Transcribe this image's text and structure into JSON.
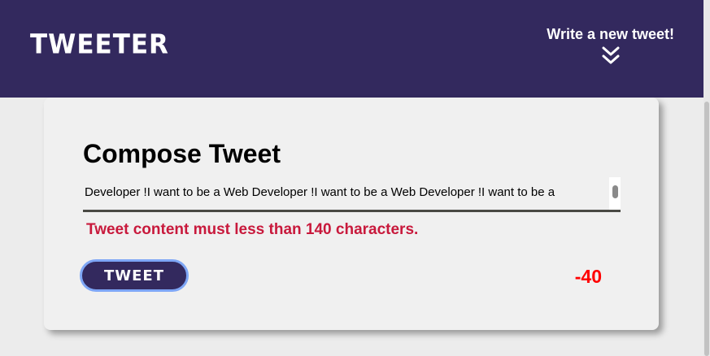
{
  "nav": {
    "logo": "TWEETER",
    "write_new_label": "Write a new tweet!",
    "write_new_icon": "double-chevron-down-icon"
  },
  "compose": {
    "title": "Compose Tweet",
    "input_value": "Developer !I want to be a Web Developer !I want to be a Web Developer !I want to be a",
    "error": "Tweet content must less than 140 characters.",
    "tweet_button": "TWEET",
    "counter": "-40"
  },
  "colors": {
    "nav_bg": "#33295e",
    "error": "#c8193c",
    "counter": "#ff0000",
    "button_focus_ring": "#7ea6f6"
  }
}
